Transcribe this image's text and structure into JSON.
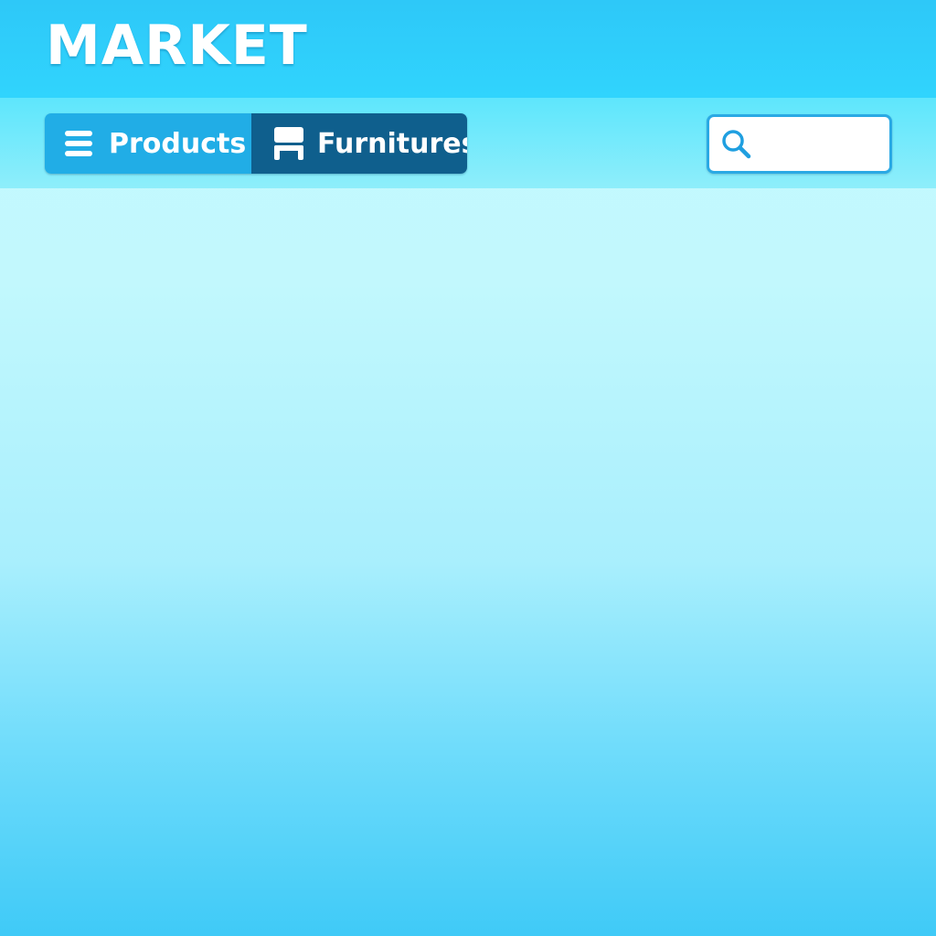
{
  "header": {
    "logo": "MARKET"
  },
  "nav": {
    "tabs": [
      {
        "label": "Products",
        "icon": "menu-icon",
        "active": false
      },
      {
        "label": "Furnitures",
        "icon": "chair-icon",
        "active": true
      }
    ]
  },
  "search": {
    "value": "",
    "placeholder": "",
    "icon": "search-icon"
  },
  "colors": {
    "header_bg": "#2ec8f8",
    "navbar_bg": "#6ae8fb",
    "tab_products_bg": "#21ade6",
    "tab_active_bg": "#0f5f8d",
    "search_border": "#2aa9e4",
    "text_light": "#ffffff"
  }
}
